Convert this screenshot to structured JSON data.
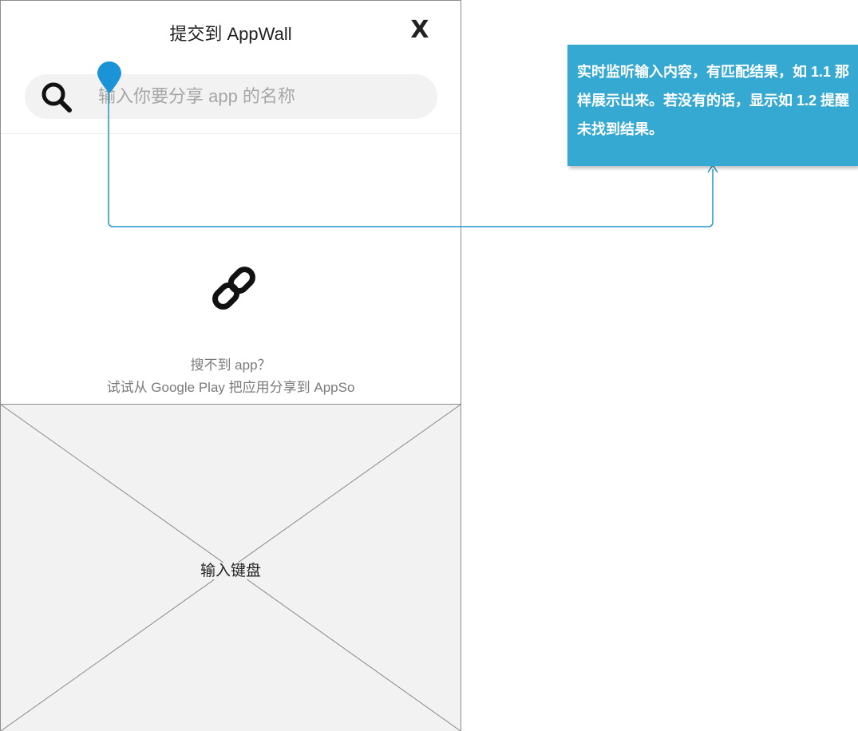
{
  "header": {
    "title": "提交到 AppWall",
    "close_label": "X"
  },
  "search": {
    "placeholder": "输入你要分享 app 的名称",
    "value": ""
  },
  "empty_state": {
    "line1": "搜不到 app？",
    "line2": "试试从 Google Play 把应用分享到 AppSo"
  },
  "keyboard": {
    "label": "输入键盘"
  },
  "annotation": {
    "text": "实时监听输入内容，有匹配结果，如 1.1 那样展示出来。若没有的话，显示如 1.2 提醒未找到结果。"
  },
  "colors": {
    "accent": "#35a9d1",
    "connector": "#2196c8",
    "placeholder_area": "#f2f2f2"
  },
  "icons": {
    "search": "search-icon",
    "link": "link-icon",
    "close": "close-icon",
    "pin": "map-pin-icon"
  }
}
